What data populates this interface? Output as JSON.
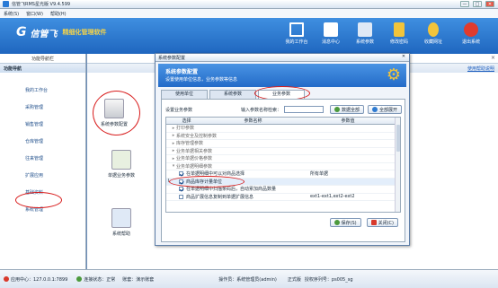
{
  "window": {
    "title": "信管飞RMS星光版 V9.4.599",
    "minimize": "—",
    "maximize": "□",
    "close": "✕"
  },
  "menubar": {
    "items": [
      "系统(S)",
      "窗口(W)",
      "帮助(H)"
    ]
  },
  "banner": {
    "logo_mark": "G",
    "brand": "信管飞",
    "tagline": "精细化管理软件",
    "toolbar": [
      {
        "label": "我的工作台",
        "icon": "desktop-icon",
        "color": "#ffffff"
      },
      {
        "label": "消息中心",
        "icon": "message-icon",
        "color": "#ffffff"
      },
      {
        "label": "系统参数",
        "icon": "settings-icon",
        "color": "#ffffff"
      },
      {
        "label": "修改密码",
        "icon": "lock-icon",
        "color": "#f2c43a"
      },
      {
        "label": "收藏网址",
        "icon": "user-icon",
        "color": "#f2c43a"
      },
      {
        "label": "退出系统",
        "icon": "exit-icon",
        "color": "#e03b2e"
      }
    ]
  },
  "left_panel": {
    "tab_label": "功能导航栏",
    "title": "功能导航",
    "items": [
      "我的工作台",
      "采购管理",
      "销售管理",
      "仓库管理",
      "往来管理",
      "扩展应用",
      "基础资料",
      "系统管理"
    ],
    "active_index": 7
  },
  "main": {
    "help_link": "使用帮助说明",
    "close": "×",
    "tiles": [
      {
        "label": "系统参数配置",
        "icon": "config-icon"
      },
      {
        "label": "单据业务参数",
        "icon": "document-icon"
      },
      {
        "label": "系统帮助",
        "icon": "help-book-icon"
      }
    ]
  },
  "dialog": {
    "title": "系统参数配置",
    "close": "✕",
    "header_title": "系统参数配置",
    "header_subtitle": "设置使用单位信息，业务参数等信息",
    "tabs": [
      "使用单位",
      "系统参数",
      "业务参数"
    ],
    "selected_tab": 2,
    "toolbar": {
      "label": "设置业务参数",
      "search_label": "输入参数名称检索：",
      "search_value": "",
      "collapse_label": "数据全部",
      "expand_label": "全部展开"
    },
    "grid": {
      "columns": [
        "选择",
        "参数名称",
        "参数值"
      ],
      "rows": [
        {
          "type": "group",
          "name": "打印参数",
          "value": ""
        },
        {
          "type": "group",
          "name": "系统安全及控制参数",
          "value": ""
        },
        {
          "type": "group",
          "name": "库存管理参数",
          "value": ""
        },
        {
          "type": "group",
          "name": "业务单据相关参数",
          "value": ""
        },
        {
          "type": "group",
          "name": "业务单据价格参数",
          "value": ""
        },
        {
          "type": "group",
          "name": "业务单据明细参数",
          "value": ""
        },
        {
          "type": "item",
          "checked": true,
          "name": "在单据明细中可以对商品选择",
          "value": "所有单据"
        },
        {
          "type": "item",
          "checked": true,
          "name": "商品库存计量单位",
          "value": "",
          "current": true
        },
        {
          "type": "item",
          "checked": true,
          "name": "在单据明细中扫描条码后，自动累加商品数量",
          "value": ""
        },
        {
          "type": "item",
          "checked": false,
          "name": "商品扩展信息复制到单据扩展信息",
          "value": "ext1-ext1,ext2-ext2"
        }
      ]
    },
    "save_label": "保存(S)",
    "close_label": "关闭(C)"
  },
  "status": {
    "app_center": "应用中心：127.0.0.1:7899",
    "connection": "连接状态：正常",
    "account": "账套：演示账套",
    "operator": "操作员：系统管理员(admin)",
    "edition": "正式版",
    "serial": "授权序列号：ps005_sg"
  },
  "annotations": {
    "color": "#d81c1c"
  }
}
